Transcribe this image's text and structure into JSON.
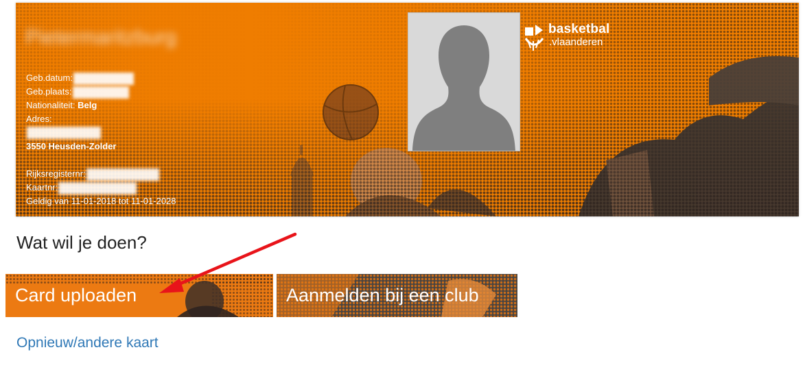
{
  "card": {
    "name": "Pietermaritzburg",
    "fields": [
      {
        "label": "Geb.datum:",
        "value": ""
      },
      {
        "label": "Geb.plaats:",
        "value": ""
      },
      {
        "label": "Nationaliteit:",
        "value": "Belg"
      },
      {
        "label": "Adres:",
        "value": ""
      },
      {
        "label": "",
        "value": "3550 Heusden-Zolder"
      },
      {
        "label": "Rijksregisternr:",
        "value": ""
      },
      {
        "label": "Kaartnr:",
        "value": ""
      },
      {
        "label": "Geldig van 11-01-2018 tot 11-01-2028",
        "value": ""
      }
    ],
    "logo": {
      "name": "basketbal",
      "sub": ".vlaanderen"
    }
  },
  "prompt": "Wat wil je doen?",
  "actions": {
    "upload_label": "Card uploaden",
    "club_label": "Aanmelden bij een club"
  },
  "link": {
    "label": "Opnieuw/andere kaart"
  },
  "colors": {
    "card_orange": "#ef7d00",
    "link_blue": "#2f78b6",
    "arrow_red": "#e8141a"
  }
}
